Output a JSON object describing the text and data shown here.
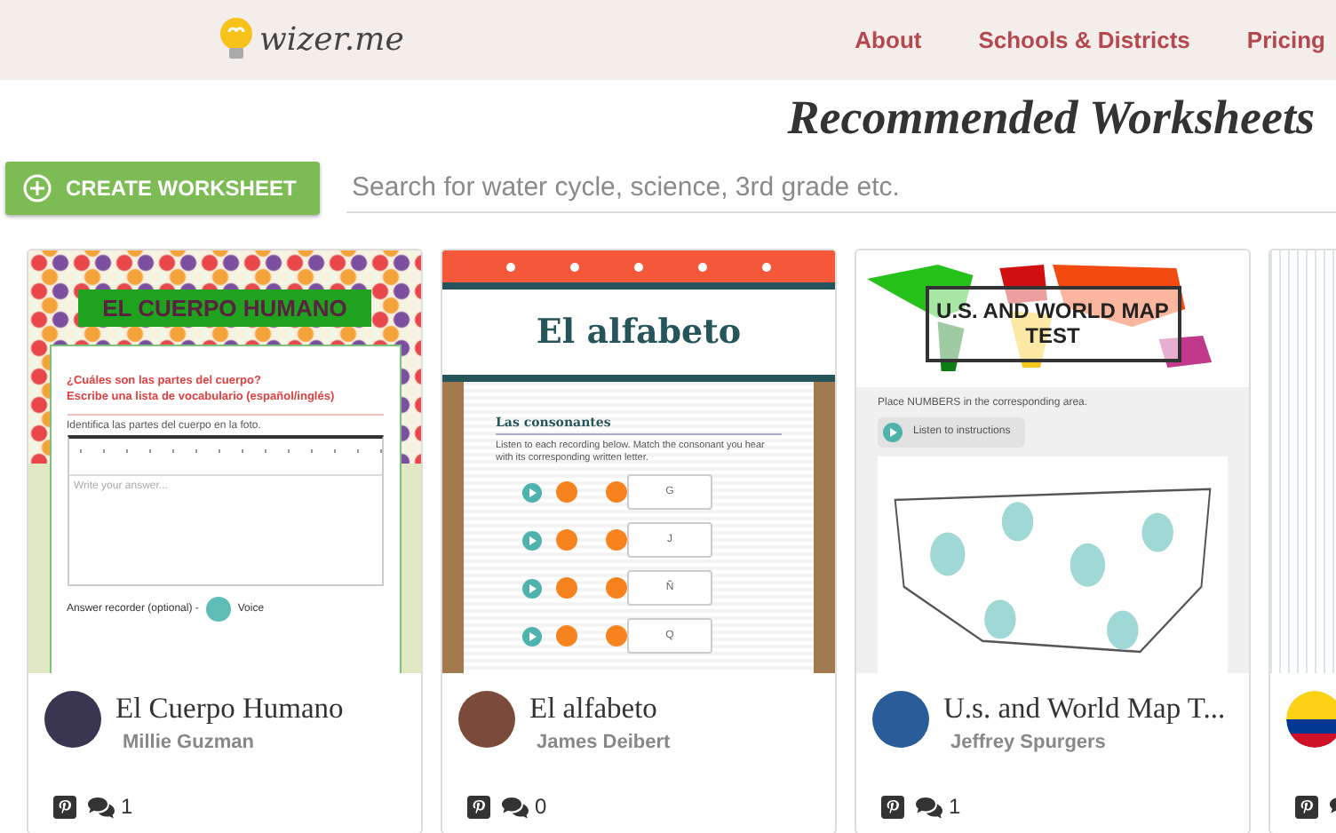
{
  "header": {
    "logo_text": "wizer.me",
    "nav": [
      {
        "label": "About"
      },
      {
        "label": "Schools & Districts"
      },
      {
        "label": "Pricing"
      }
    ]
  },
  "page_title": "Recommended Worksheets",
  "toolbar": {
    "create_button": "CREATE WORKSHEET",
    "search": {
      "placeholder": "Search for water cycle, science, 3rd grade etc."
    }
  },
  "cards": [
    {
      "title": "El Cuerpo Humano",
      "author": "Millie Guzman",
      "comments": "1",
      "preview": {
        "kind": "cuerpo",
        "heading": "EL CUERPO HUMANO",
        "questions": [
          "¿Cuáles son las partes del cuerpo?",
          "Escribe una lista de vocabulario (español/inglés)"
        ],
        "instruction": "Identifica las partes del cuerpo en la foto.",
        "answer_placeholder": "Write your answer...",
        "recorder_label": "Answer recorder (optional) -",
        "voice_label": "Voice"
      }
    },
    {
      "title": "El alfabeto",
      "author": "James Deibert",
      "comments": "0",
      "preview": {
        "kind": "alfabeto",
        "heading": "El alfabeto",
        "section": "Las consonantes",
        "instruction": "Listen to each recording below. Match the consonant you hear with its corresponding written letter.",
        "letters": [
          "G",
          "J",
          "Ñ",
          "Q"
        ]
      }
    },
    {
      "title": "U.s. and World Map T...",
      "author": "Jeffrey Spurgers",
      "comments": "1",
      "preview": {
        "kind": "map",
        "heading": "U.S. AND WORLD MAP TEST",
        "instruction": "Place NUMBERS in the corresponding area.",
        "listen_label": "Listen to instructions"
      }
    }
  ]
}
